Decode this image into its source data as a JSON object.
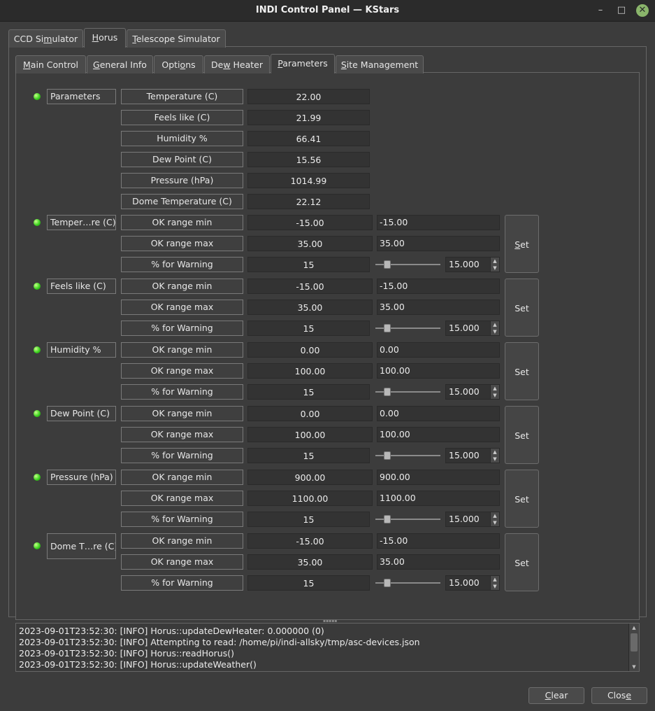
{
  "window": {
    "title": "INDI Control Panel — KStars",
    "minimize_glyph": "–",
    "maximize_glyph": "□",
    "close_glyph": "✕"
  },
  "device_tabs": [
    {
      "pre": "CCD Si",
      "u": "m",
      "post": "ulator"
    },
    {
      "pre": "",
      "u": "H",
      "post": "orus"
    },
    {
      "pre": "",
      "u": "T",
      "post": "elescope Simulator"
    }
  ],
  "group_tabs": [
    {
      "pre": "",
      "u": "M",
      "post": "ain Control"
    },
    {
      "pre": "",
      "u": "G",
      "post": "eneral Info"
    },
    {
      "pre": "Opti",
      "u": "o",
      "post": "ns"
    },
    {
      "pre": "De",
      "u": "w",
      "post": " Heater"
    },
    {
      "pre": "",
      "u": "P",
      "post": "arameters"
    },
    {
      "pre": "",
      "u": "S",
      "post": "ite Management"
    }
  ],
  "parameters": {
    "label": "Parameters",
    "rows": [
      {
        "label": "Temperature (C)",
        "value": "22.00"
      },
      {
        "label": "Feels like (C)",
        "value": "21.99"
      },
      {
        "label": "Humidity %",
        "value": "66.41"
      },
      {
        "label": "Dew Point (C)",
        "value": "15.56"
      },
      {
        "label": "Pressure (hPa)",
        "value": "1014.99"
      },
      {
        "label": "Dome Temperature (C)",
        "value": "22.12"
      }
    ]
  },
  "limits": [
    {
      "label": "Temper…re (C)",
      "min": "-15.00",
      "min_edit": "-15.00",
      "max": "35.00",
      "max_edit": "35.00",
      "warn": "15",
      "warn_spin": "15.000",
      "warn_slider_fraction": 0.15,
      "set_label": "Set",
      "set_underline": true
    },
    {
      "label": "Feels like (C)",
      "min": "-15.00",
      "min_edit": "-15.00",
      "max": "35.00",
      "max_edit": "35.00",
      "warn": "15",
      "warn_spin": "15.000",
      "warn_slider_fraction": 0.15,
      "set_label": "Set",
      "set_underline": false
    },
    {
      "label": "Humidity %",
      "min": "0.00",
      "min_edit": "0.00",
      "max": "100.00",
      "max_edit": "100.00",
      "warn": "15",
      "warn_spin": "15.000",
      "warn_slider_fraction": 0.15,
      "set_label": "Set",
      "set_underline": false
    },
    {
      "label": "Dew Point (C)",
      "min": "0.00",
      "min_edit": "0.00",
      "max": "100.00",
      "max_edit": "100.00",
      "warn": "15",
      "warn_spin": "15.000",
      "warn_slider_fraction": 0.15,
      "set_label": "Set",
      "set_underline": false
    },
    {
      "label": "Pressure (hPa)",
      "min": "900.00",
      "min_edit": "900.00",
      "max": "1100.00",
      "max_edit": "1100.00",
      "warn": "15",
      "warn_spin": "15.000",
      "warn_slider_fraction": 0.15,
      "set_label": "Set",
      "set_underline": false
    },
    {
      "label": "Dome T…re (C)",
      "min": "-15.00",
      "min_edit": "-15.00",
      "max": "35.00",
      "max_edit": "35.00",
      "warn": "15",
      "warn_spin": "15.000",
      "warn_slider_fraction": 0.15,
      "set_label": "Set",
      "set_underline": false
    }
  ],
  "limit_row_labels": {
    "min": "OK range min",
    "max": "OK range max",
    "warn": "% for Warning"
  },
  "log": [
    "2023-09-01T23:52:30: [INFO] Horus::updateDewHeater: 0.000000 (0)",
    "2023-09-01T23:52:30: [INFO] Attempting to read: /home/pi/indi-allsky/tmp/asc-devices.json",
    "2023-09-01T23:52:30: [INFO] Horus::readHorus()",
    "2023-09-01T23:52:30: [INFO] Horus::updateWeather()"
  ],
  "buttons": {
    "clear": {
      "pre": "",
      "u": "C",
      "post": "lear"
    },
    "close": {
      "pre": "Clos",
      "u": "e",
      "post": ""
    }
  },
  "colors": {
    "led": "#3bd21f",
    "background": "#3c3c3c"
  }
}
